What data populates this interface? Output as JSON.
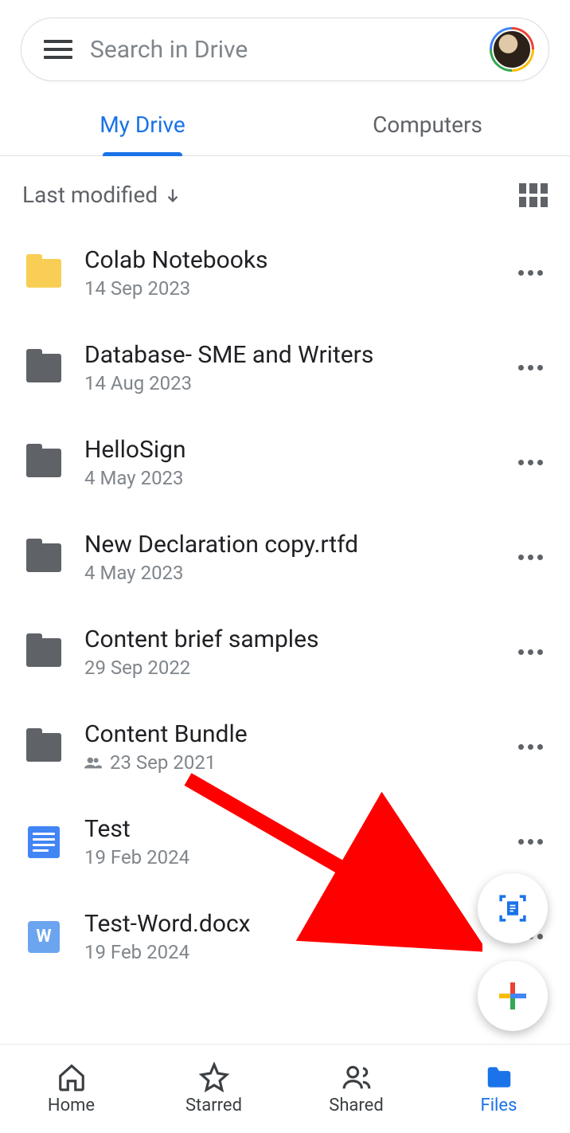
{
  "search": {
    "placeholder": "Search in Drive"
  },
  "tabs": {
    "my_drive": "My Drive",
    "computers": "Computers",
    "active": 0
  },
  "sort": {
    "label": "Last modified"
  },
  "files": [
    {
      "name": "Colab Notebooks",
      "meta": "14 Sep 2023",
      "icon": "folder-yellow",
      "shared": false
    },
    {
      "name": "Database- SME and Writers",
      "meta": "14 Aug 2023",
      "icon": "folder-gray",
      "shared": false
    },
    {
      "name": "HelloSign",
      "meta": "4 May 2023",
      "icon": "folder-gray",
      "shared": false
    },
    {
      "name": "New Declaration copy.rtfd",
      "meta": "4 May 2023",
      "icon": "folder-gray",
      "shared": false
    },
    {
      "name": "Content brief samples",
      "meta": "29 Sep 2022",
      "icon": "folder-gray",
      "shared": false
    },
    {
      "name": "Content Bundle",
      "meta": "23 Sep 2021",
      "icon": "folder-gray",
      "shared": true
    },
    {
      "name": "Test",
      "meta": "19 Feb 2024",
      "icon": "doc",
      "shared": false
    },
    {
      "name": "Test-Word.docx",
      "meta": "19 Feb 2024",
      "icon": "word",
      "shared": false
    }
  ],
  "bottom_nav": {
    "home": "Home",
    "starred": "Starred",
    "shared": "Shared",
    "files": "Files",
    "active": 3
  },
  "colors": {
    "accent": "#1a73e8",
    "text_primary": "#202124",
    "text_secondary": "#5f6368"
  }
}
